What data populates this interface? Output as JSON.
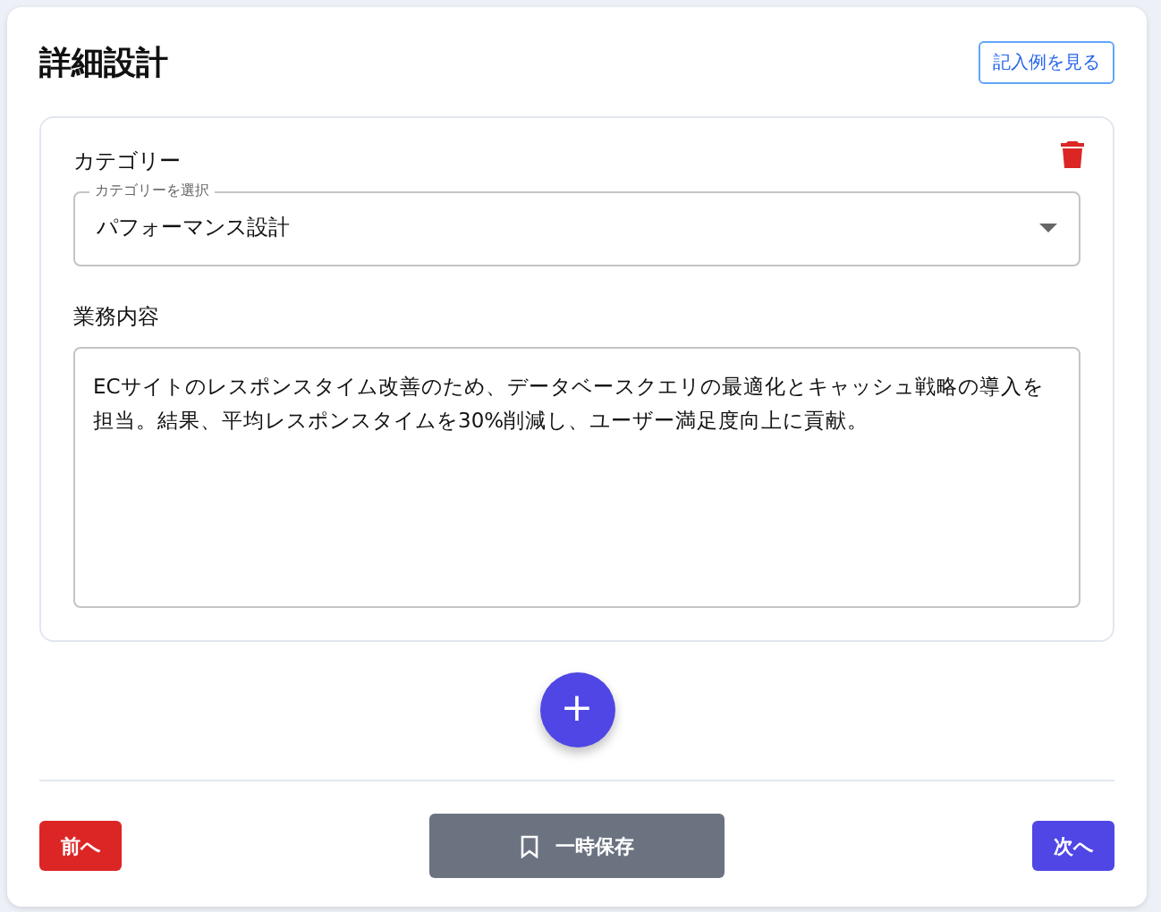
{
  "title": "詳細設計",
  "example_button": "記入例を見る",
  "entry": {
    "category_label": "カテゴリー",
    "select_label": "カテゴリーを選択",
    "select_value": "パフォーマンス設計",
    "task_label": "業務内容",
    "task_value": "ECサイトのレスポンスタイム改善のため、データベースクエリの最適化とキャッシュ戦略の導入を担当。結果、平均レスポンスタイムを30%削減し、ユーザー満足度向上に貢献。"
  },
  "add_button": "+",
  "footer": {
    "prev": "前へ",
    "save": "一時保存",
    "next": "次へ"
  }
}
